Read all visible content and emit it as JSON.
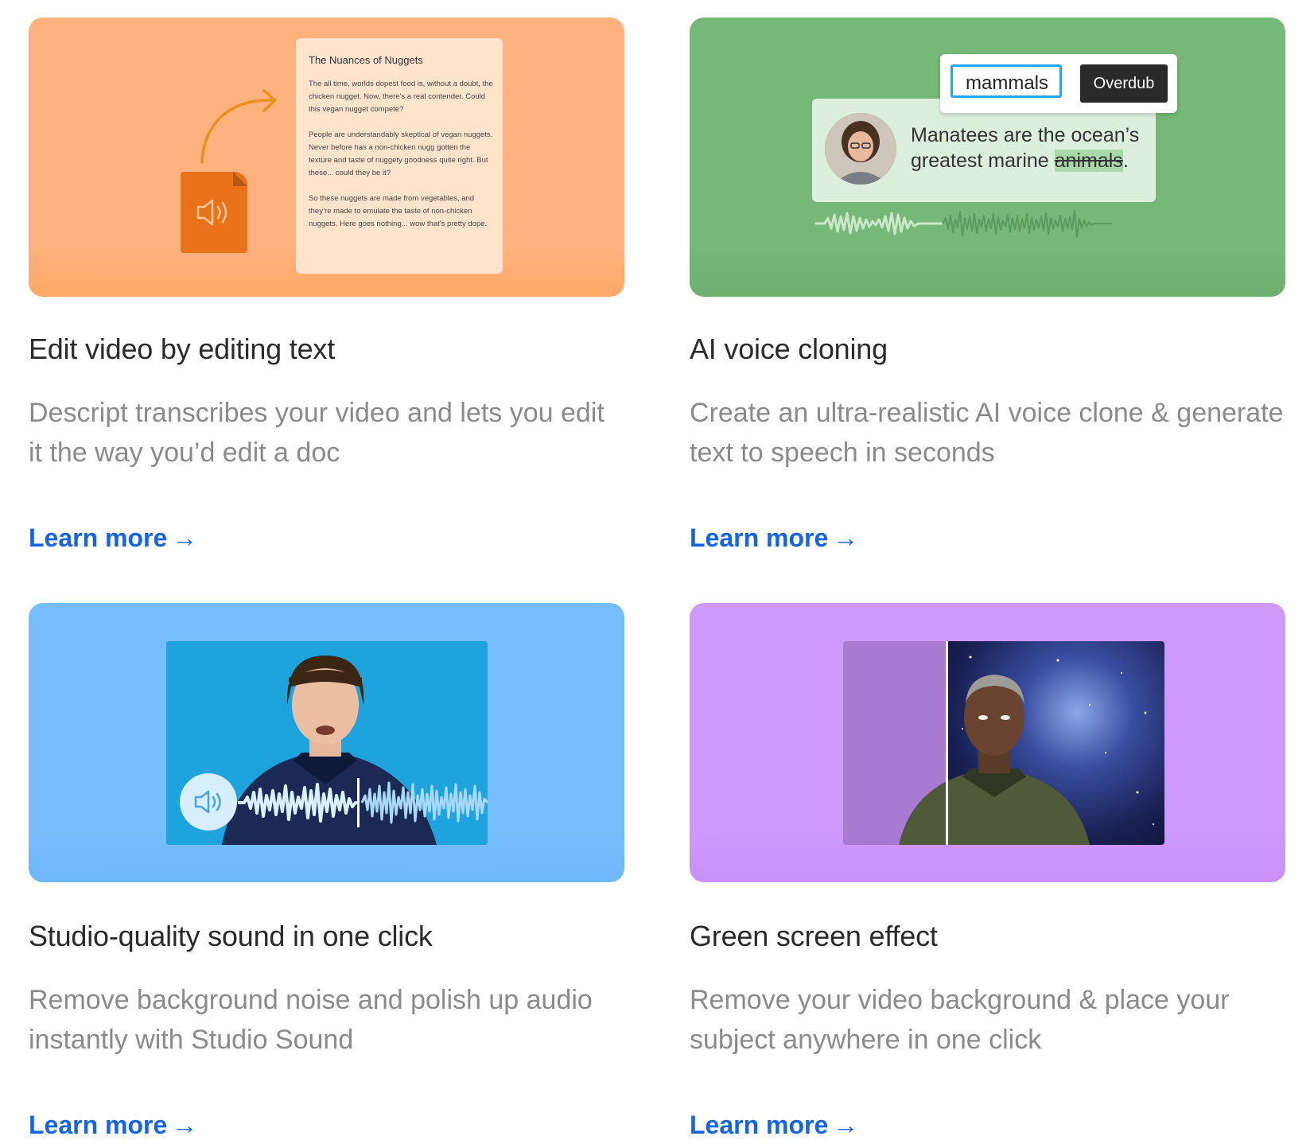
{
  "features": [
    {
      "title": "Edit video by editing text",
      "description": "Descript transcribes your video and lets you edit it the way you’d edit a doc",
      "link_label": "Learn more",
      "link_arrow": "→",
      "illustration": {
        "doc_title": "The Nuances of Nuggets",
        "doc_body": "The all time, worlds dopest food is, without a doubt, the  chicken nugget. Now, there's a real contender. Could this vegan nugget compete?\n\nPeople are understandably skeptical of vegan nuggets. Never before has a non-chicken nugg gotten the texture and taste of nuggety goodness  quite right. But these... could they be it?\n\nSo these nuggets are made from vegetables, and they’re made to emulate the taste of non-chicken nuggets. Here goes nothing... wow that's pretty dope.",
        "file_icon": "audio-file-icon",
        "arrow_icon": "curved-arrow-icon",
        "bg_color": "#fdb27e"
      }
    },
    {
      "title": "AI voice cloning",
      "description": "Create an ultra-realistic AI voice clone & generate text to speech in seconds",
      "link_label": "Learn more",
      "link_arrow": "→",
      "illustration": {
        "input_value": "mammals",
        "button_label": "Overdub",
        "quote_text": "Manatees are the ocean’s greatest marine",
        "struck_word": "animals",
        "quote_end": ".",
        "bg_color": "#76b877"
      }
    },
    {
      "title": "Studio-quality sound in one click",
      "description": "Remove background noise and polish up audio instantly with Studio Sound",
      "link_label": "Learn more",
      "link_arrow": "→",
      "illustration": {
        "speaker_icon": "speaker-icon",
        "bg_color": "#76bdfb"
      }
    },
    {
      "title": "Green screen effect",
      "description": "Remove your video background & place your subject anywhere in one click",
      "link_label": "Learn more",
      "link_arrow": "→",
      "illustration": {
        "bg_color": "#cf98fb"
      }
    }
  ],
  "colors": {
    "link": "#1463e8",
    "title": "#2a2a2a",
    "description": "#8a8a8a"
  }
}
